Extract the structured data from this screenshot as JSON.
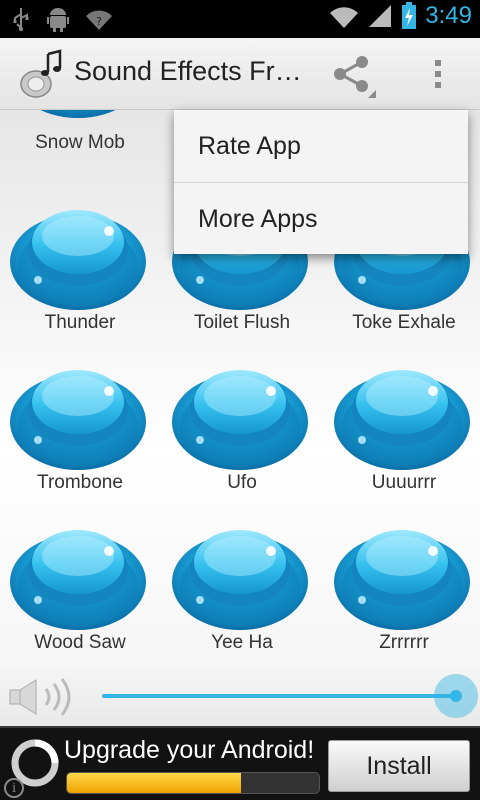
{
  "status_bar": {
    "time": "3:49",
    "icons": [
      "usb-icon",
      "android-debug-icon",
      "wifi-question-icon",
      "wifi-icon",
      "signal-icon",
      "battery-charging-icon"
    ]
  },
  "action_bar": {
    "title": "Sound Effects Fr…",
    "app_icon": "music-speaker-icon",
    "share_icon": "share-icon",
    "overflow_icon": "overflow-menu-icon"
  },
  "sounds": [
    {
      "label": "Snow Mob"
    },
    {
      "label": "Thunder"
    },
    {
      "label": "Toilet Flush"
    },
    {
      "label": "Toke Exhale"
    },
    {
      "label": "Trombone"
    },
    {
      "label": "Ufo"
    },
    {
      "label": "Uuuurrr"
    },
    {
      "label": "Wood Saw"
    },
    {
      "label": "Yee Ha"
    },
    {
      "label": "Zrrrrrr"
    }
  ],
  "overflow_menu": {
    "items": [
      {
        "label": "Rate App"
      },
      {
        "label": "More Apps"
      }
    ]
  },
  "volume": {
    "icon": "speaker-volume-icon",
    "level": 1.0
  },
  "ad": {
    "headline": "Upgrade your Android!",
    "button_label": "Install",
    "progress": 0.69,
    "info_glyph": "i"
  },
  "colors": {
    "accent": "#33b5e5",
    "button_blue": "#1aa3d9"
  }
}
